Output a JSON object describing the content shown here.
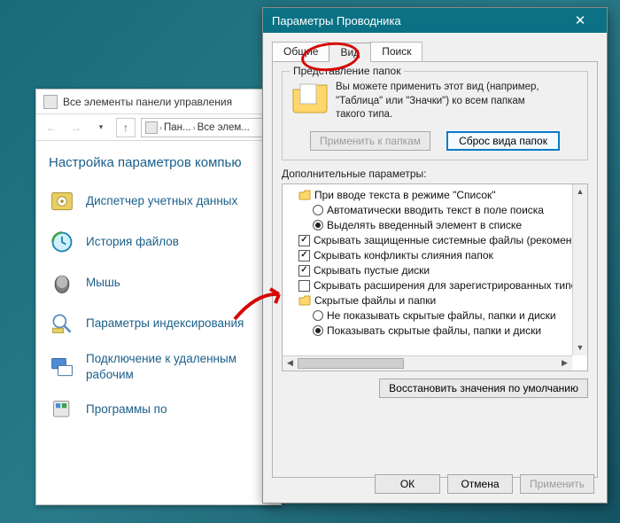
{
  "bgwin": {
    "title": "Все элементы панели управления",
    "crumb1": "Пан...",
    "crumb2": "Все элем...",
    "heading": "Настройка параметров компью",
    "items": [
      "Диспетчер учетных данных",
      "История файлов",
      "Мышь",
      "Параметры индексирования",
      "Подключение к удаленным рабочим",
      "Программы по"
    ]
  },
  "dlg": {
    "title": "Параметры Проводника",
    "tabs": {
      "general": "Общие",
      "view": "Вид",
      "search": "Поиск"
    },
    "fv_group_title": "Представление папок",
    "fv_text_l1": "Вы можете применить этот вид (например,",
    "fv_text_l2": "\"Таблица\" или \"Значки\") ко всем папкам",
    "fv_text_l3": "такого типа.",
    "btn_apply_folders": "Применить к папкам",
    "btn_reset_folders": "Сброс вида папок",
    "adv_label": "Дополнительные параметры:",
    "tree": {
      "n0": "При вводе текста в режиме \"Список\"",
      "n0a": "Автоматически вводить текст в поле поиска",
      "n0b": "Выделять введенный элемент в списке",
      "c1": "Скрывать защищенные системные файлы (рекомен",
      "c2": "Скрывать конфликты слияния папок",
      "c3": "Скрывать пустые диски",
      "c4": "Скрывать расширения для зарегистрированных типо",
      "n1": "Скрытые файлы и папки",
      "r1": "Не показывать скрытые файлы, папки и диски",
      "r2": "Показывать скрытые файлы, папки и диски"
    },
    "btn_restore": "Восстановить значения по умолчанию",
    "btn_ok": "ОК",
    "btn_cancel": "Отмена",
    "btn_apply": "Применить"
  }
}
